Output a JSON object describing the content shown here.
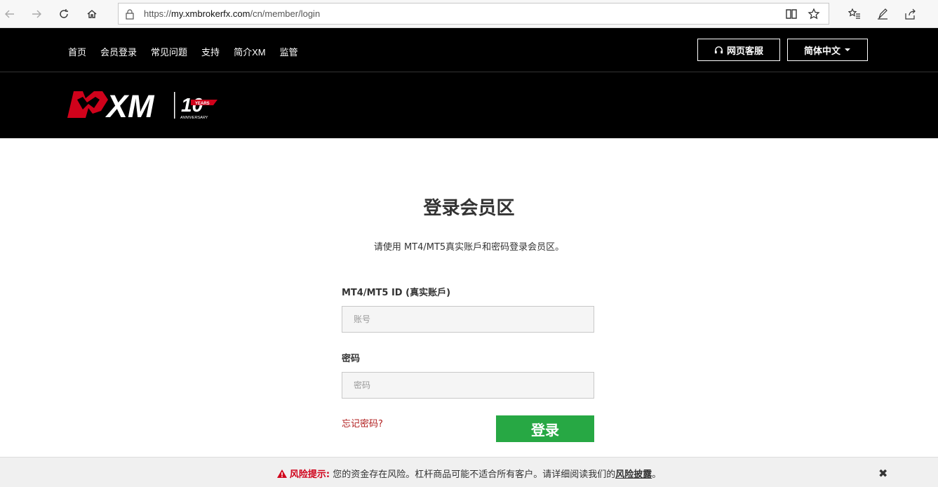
{
  "browser": {
    "url_prefix": "https://",
    "url_host": "my.xmbrokerfx.com",
    "url_path": "/cn/member/login",
    "icons": [
      "back-icon",
      "forward-icon",
      "refresh-icon",
      "home-icon",
      "lock-icon",
      "reading-view-icon",
      "favorite-star-icon",
      "favorites-list-icon",
      "pen-icon",
      "share-icon"
    ]
  },
  "header": {
    "nav": [
      "首页",
      "会员登录",
      "常见问题",
      "支持",
      "简介XM",
      "监管"
    ],
    "support_label": "网页客服",
    "language_label": "简体中文",
    "logo_text": "XM",
    "anniversary_number": "10",
    "anniversary_years": "YEARS",
    "anniversary_label": "ANNIVERSARY"
  },
  "main": {
    "title": "登录会员区",
    "subtitle": "请使用 MT4/MT5真实账戶和密码登录会员区。",
    "account_label": "MT4/MT5 ID (真实账戶)",
    "account_placeholder": "账号",
    "password_label": "密码",
    "password_placeholder": "密码",
    "forgot_label": "忘记密码?",
    "login_label": "登录"
  },
  "risk_banner": {
    "prefix": "风险提示:",
    "text": " 您的资金存在风险。杠杆商品可能不适合所有客户。请详细阅读我们的",
    "link": "风险披露",
    "suffix": "。",
    "close": "✖"
  },
  "colors": {
    "brand_red": "#d0021b",
    "login_green": "#27a844",
    "header_bg": "#000000"
  }
}
